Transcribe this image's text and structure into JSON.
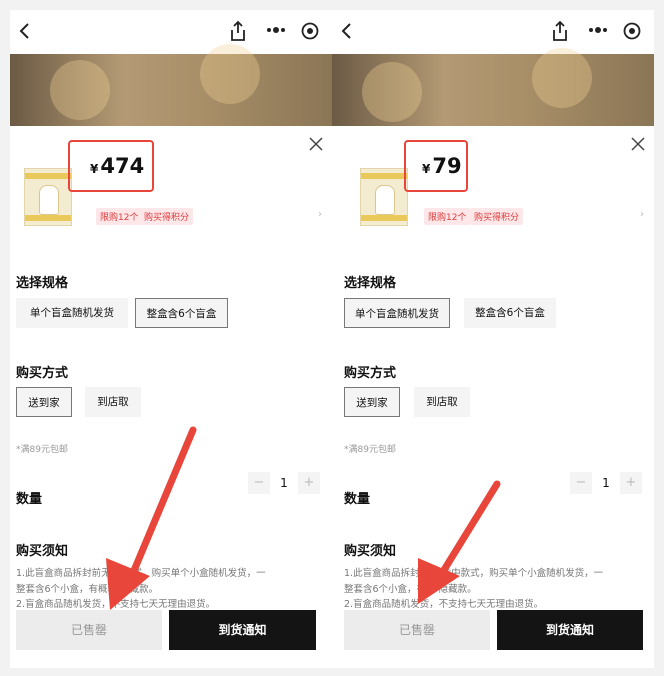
{
  "panels": [
    {
      "price": "474",
      "currency": "¥",
      "tags": [
        "限购12个",
        "购买得积分"
      ],
      "spec_title": "选择规格",
      "spec_options": [
        "单个盲盒随机发货",
        "整盒含6个盲盒"
      ],
      "spec_selected": 1,
      "method_title": "购买方式",
      "method_options": [
        "送到家",
        "到店取"
      ],
      "method_selected": 0,
      "shipping_note": "*满89元包邮",
      "quantity_label": "数量",
      "quantity": "1",
      "notice_title": "购买须知",
      "notice_lines": [
        "1.此盲盒商品拆封前无    中款式，购买单个小盒随机发货，一",
        "整套含6个小盒，有概率    隐藏款。",
        "2.盲盒商品随机发货，不支持七天无理由退货。"
      ],
      "soldout_label": "已售罄",
      "notify_label": "到货通知"
    },
    {
      "price": "79",
      "currency": "¥",
      "tags": [
        "限购12个",
        "购买得积分"
      ],
      "spec_title": "选择规格",
      "spec_options": [
        "单个盲盒随机发货",
        "整盒含6个盲盒"
      ],
      "spec_selected": 0,
      "method_title": "购买方式",
      "method_options": [
        "送到家",
        "到店取"
      ],
      "method_selected": 0,
      "shipping_note": "*满89元包邮",
      "quantity_label": "数量",
      "quantity": "1",
      "notice_title": "购买须知",
      "notice_lines": [
        "1.此盲盒商品拆封前    晓盒中款式，购买单个小盒随机发货，一",
        "整套含6个小盒，有    中隐藏款。",
        "2.盲盒商品随机发货，不支持七天无理由退货。"
      ],
      "soldout_label": "已售罄",
      "notify_label": "到货通知"
    }
  ],
  "colors": {
    "highlight": "#e8463a",
    "tag_text": "#e03a3a",
    "tag_bg": "#fde7e8",
    "notify_bg": "#141414"
  },
  "icons": [
    "back-icon",
    "share-icon",
    "more-icon",
    "target-icon",
    "close-icon",
    "chevron-right-icon",
    "minus-icon",
    "plus-icon"
  ]
}
